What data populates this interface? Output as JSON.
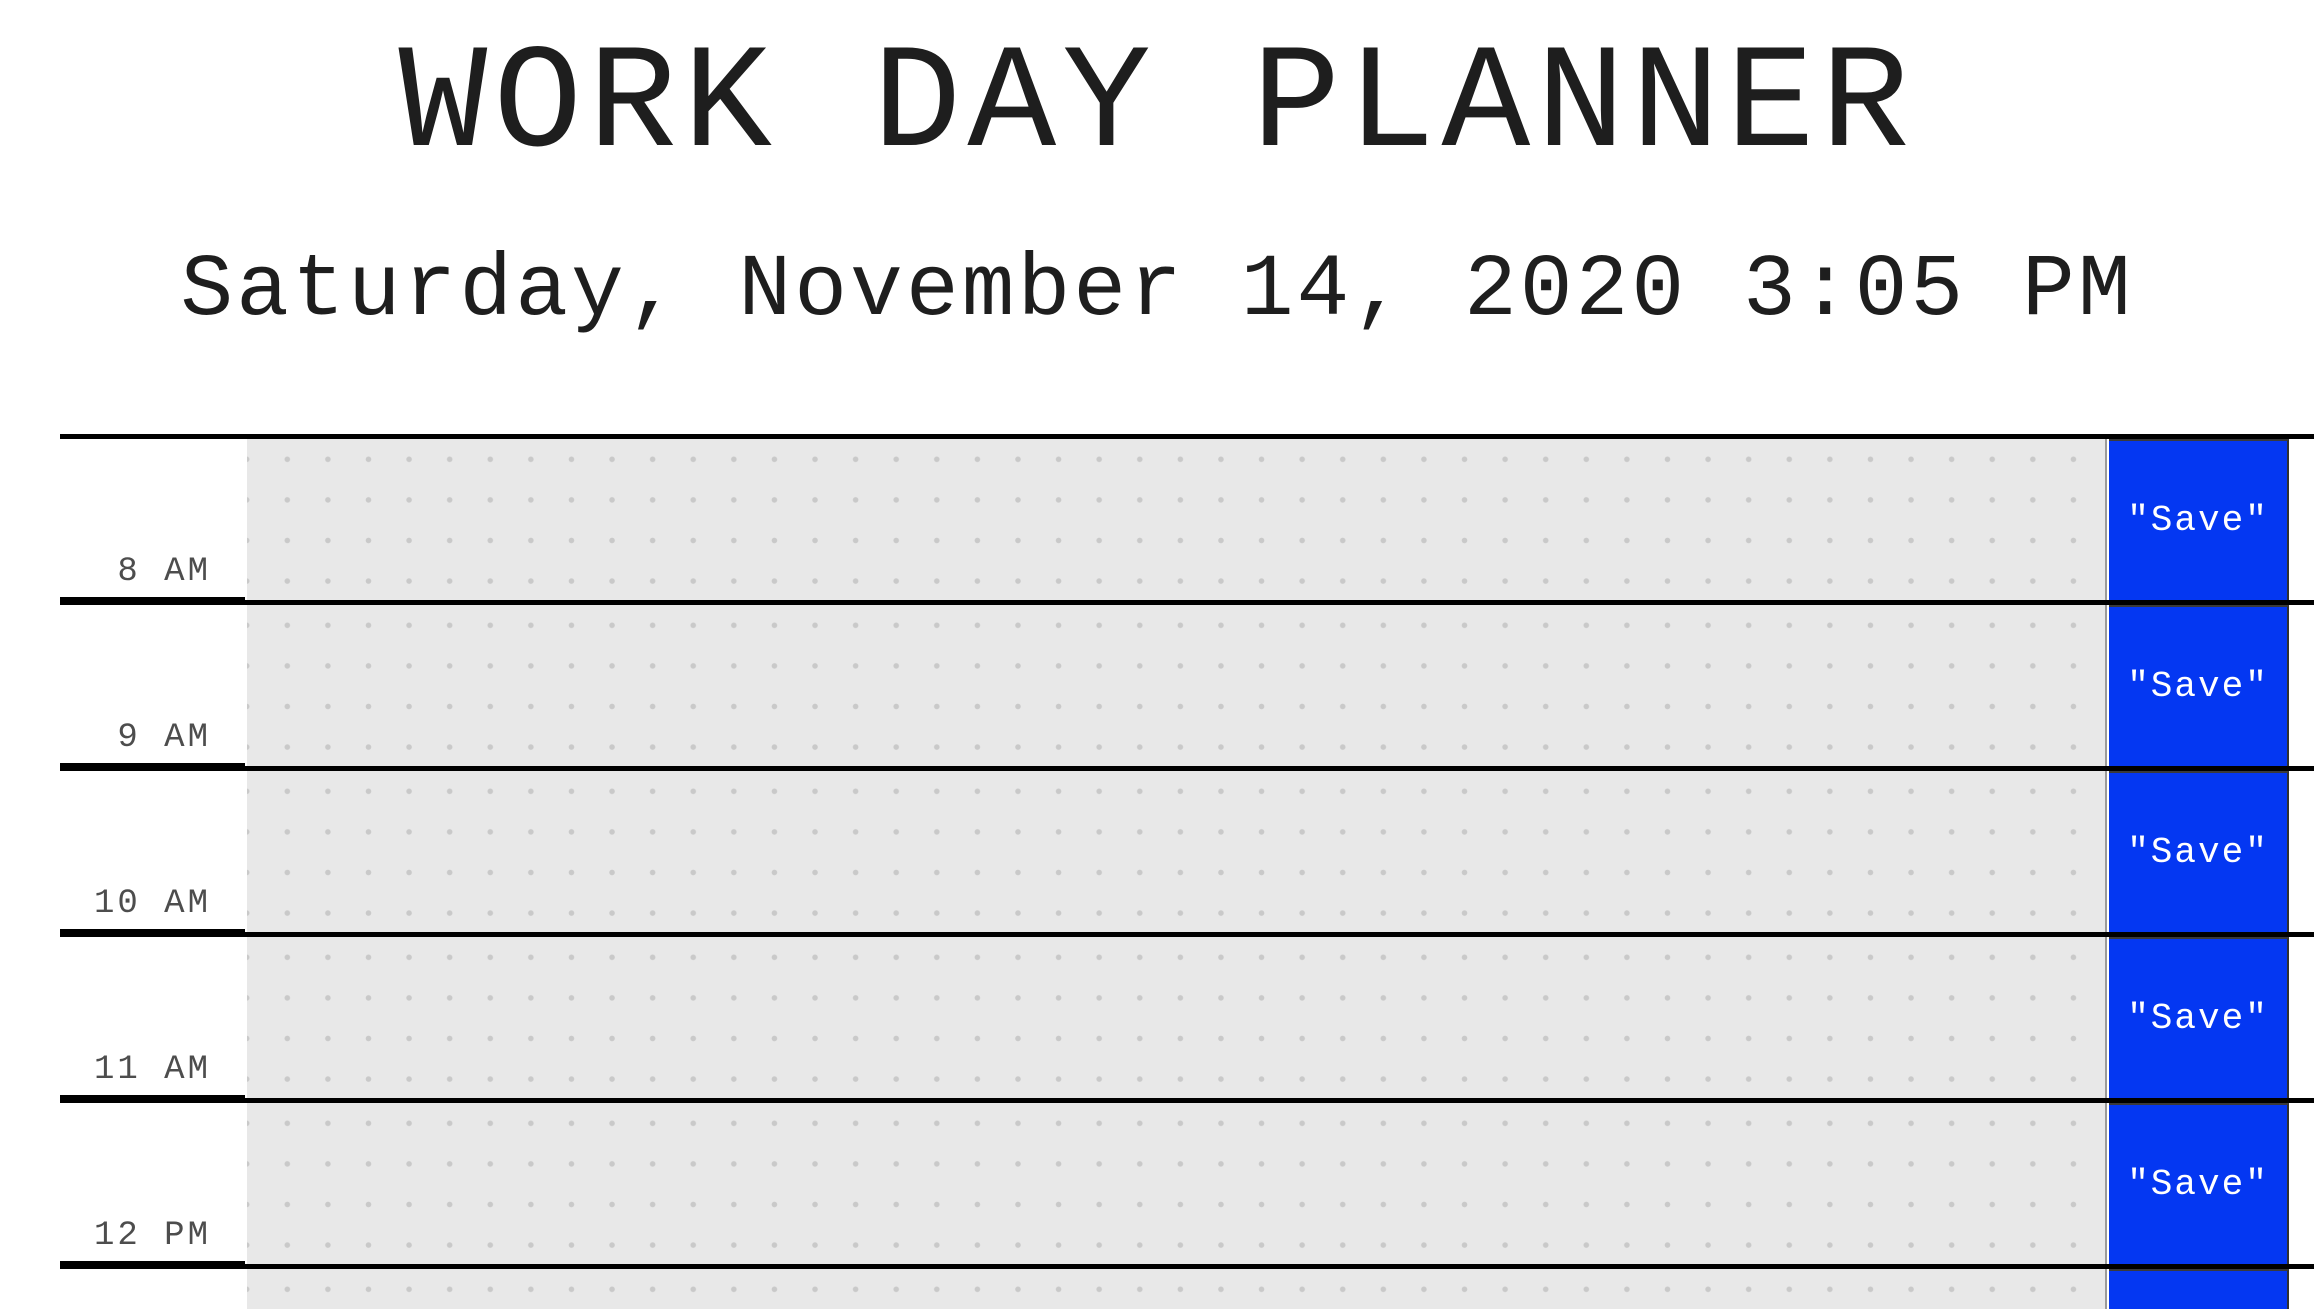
{
  "header": {
    "title": "WORK DAY PLANNER",
    "current_datetime": "Saturday, November 14, 2020 3:05 PM"
  },
  "planner": {
    "save_label": "\"Save\"",
    "rows": [
      {
        "hour": "8 AM",
        "text": ""
      },
      {
        "hour": "9 AM",
        "text": ""
      },
      {
        "hour": "10 AM",
        "text": ""
      },
      {
        "hour": "11 AM",
        "text": ""
      },
      {
        "hour": "12 PM",
        "text": ""
      }
    ]
  },
  "colors": {
    "save_button": "#0437f2",
    "past_block": "#e8e8e8"
  }
}
